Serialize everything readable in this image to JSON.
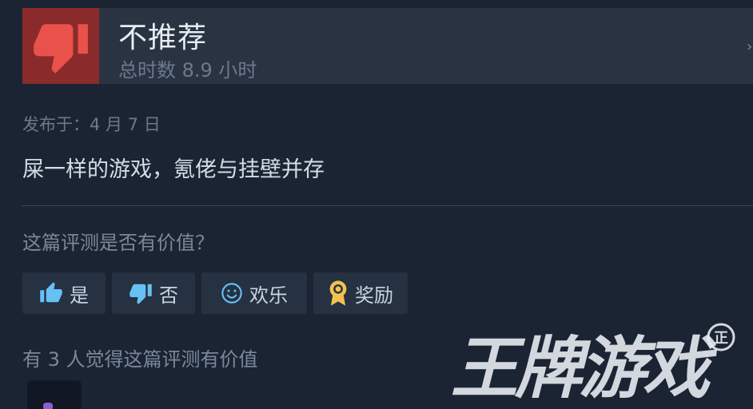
{
  "review": {
    "verdict": "不推荐",
    "hours": "总时数 8.9 小时",
    "posted": "发布于：4 月 7 日",
    "text": "屎一样的游戏，氪佬与挂壁并存"
  },
  "helpful": {
    "question": "这篇评测是否有价值？",
    "yes_label": "是",
    "no_label": "否",
    "funny_label": "欢乐",
    "award_label": "奖励",
    "count_text": "有 3 人觉得这篇评测有价值"
  },
  "icons": {
    "verdict": "thumbs-down-icon",
    "yes": "thumbs-up-icon",
    "no": "thumbs-down-icon",
    "funny": "smiley-icon",
    "award": "award-ribbon-icon"
  },
  "colors": {
    "background": "#1b2433",
    "header": "#2a3342",
    "thumb_bg": "#8b2a2a",
    "thumb_fg": "#e8524b",
    "accent_blue": "#67c1f5",
    "award_gold": "#f2c14e"
  },
  "watermark": {
    "text": "王牌游戏",
    "badge": "正"
  }
}
